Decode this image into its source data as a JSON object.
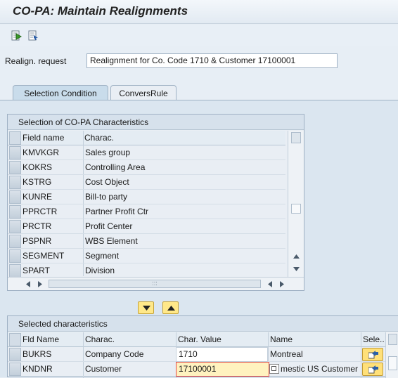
{
  "window": {
    "title": "CO-PA: Maintain Realignments"
  },
  "toolbar": {
    "icons": [
      "execute-icon",
      "display-log-icon"
    ]
  },
  "request": {
    "label": "Realign. request",
    "value": "Realignment for Co. Code 1710 & Customer 17100001"
  },
  "tabs": [
    {
      "label": "Selection Condition",
      "active": true
    },
    {
      "label": "ConversRule",
      "active": false
    }
  ],
  "selection_panel": {
    "title": "Selection of CO-PA Characteristics",
    "columns": [
      "Field name",
      "Charac."
    ],
    "rows": [
      {
        "field": "KMVKGR",
        "charac": "Sales group"
      },
      {
        "field": "KOKRS",
        "charac": "Controlling Area"
      },
      {
        "field": "KSTRG",
        "charac": "Cost Object"
      },
      {
        "field": "KUNRE",
        "charac": "Bill-to party"
      },
      {
        "field": "PPRCTR",
        "charac": "Partner Profit Ctr"
      },
      {
        "field": "PRCTR",
        "charac": "Profit Center"
      },
      {
        "field": "PSPNR",
        "charac": "WBS Element"
      },
      {
        "field": "SEGMENT",
        "charac": "Segment"
      },
      {
        "field": "SPART",
        "charac": "Division"
      }
    ],
    "hscroll_grip": ":::"
  },
  "selected_panel": {
    "title": "Selected characteristics",
    "columns": [
      "Fld Name",
      "Charac.",
      "Char. Value",
      "Name",
      "Sele.."
    ],
    "rows": [
      {
        "field": "BUKRS",
        "charac": "Company Code",
        "value": "1710",
        "name": "Montreal"
      },
      {
        "field": "KNDNR",
        "charac": "Customer",
        "value": "17100001",
        "name": "mestic US Customer"
      }
    ]
  },
  "colors": {
    "background": "#e7eef5",
    "button_yellow": "#ffe889",
    "focus_border": "#e34a4a"
  }
}
